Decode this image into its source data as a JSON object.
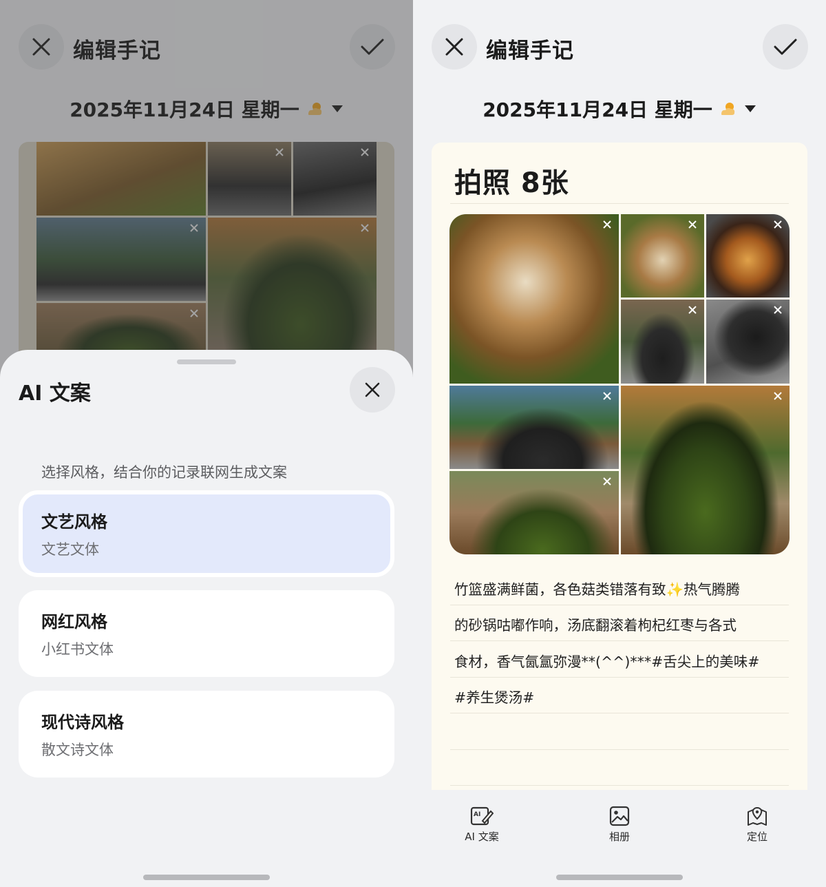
{
  "left": {
    "header": {
      "title": "编辑手记"
    },
    "date": "2025年11月24日 星期一",
    "sheet": {
      "title": "AI 文案",
      "hint": "选择风格，结合你的记录联网生成文案",
      "styles": [
        {
          "name": "文艺风格",
          "sub": "文艺文体",
          "selected": true
        },
        {
          "name": "网红风格",
          "sub": "小红书文体",
          "selected": false
        },
        {
          "name": "现代诗风格",
          "sub": "散文诗文体",
          "selected": false
        }
      ]
    }
  },
  "right": {
    "header": {
      "title": "编辑手记"
    },
    "date": "2025年11月24日 星期一",
    "note": {
      "title": "拍照 8张",
      "lines": [
        "竹篮盛满鲜菌，各色菇类错落有致✨热气腾腾",
        "的砂锅咕嘟作响，汤底翻滚着枸杞红枣与各式",
        "食材，香气氤氲弥漫**(^^)***#舌尖上的美味#",
        "#养生煲汤#"
      ]
    },
    "toolbar": [
      {
        "label": "AI 文案",
        "icon": "ai-copy-icon"
      },
      {
        "label": "相册",
        "icon": "album-icon"
      },
      {
        "label": "定位",
        "icon": "location-icon"
      }
    ]
  },
  "colors": {
    "background": "#f1f2f4",
    "selected_card": "#e3e9fb",
    "note_paper": "#fdfaf0",
    "weather_icon": "#f0a623"
  }
}
